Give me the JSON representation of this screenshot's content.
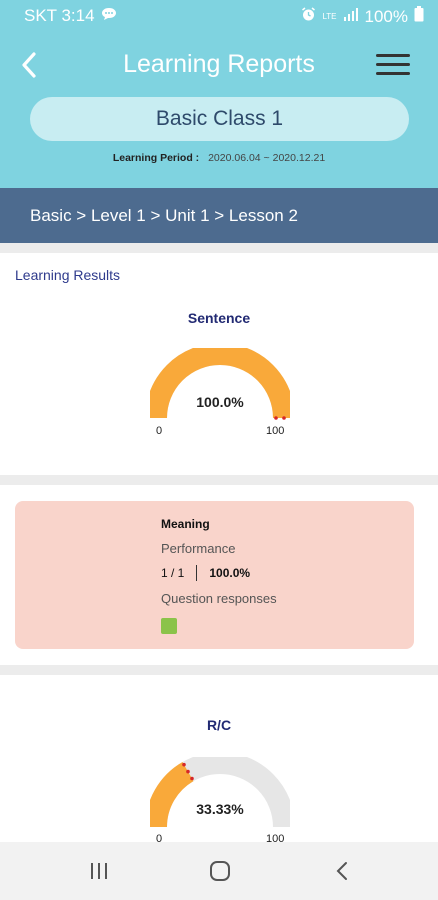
{
  "status_bar": {
    "carrier_time": "SKT 3:14",
    "network": "LTE",
    "battery": "100%",
    "icons": [
      "chat-bubble-icon",
      "alarm-icon",
      "lte-icon",
      "signal-icon",
      "battery-icon"
    ]
  },
  "header": {
    "title": "Learning Reports",
    "class_name": "Basic Class 1",
    "period_label": "Learning Period :",
    "period_value": "2020.06.04 ~ 2020.12.21"
  },
  "breadcrumb": "Basic > Level 1 > Unit 1 > Lesson 2",
  "results": {
    "section_label": "Learning Results",
    "sentence": {
      "title": "Sentence",
      "value_text": "100.0%",
      "fraction": 1.0,
      "min": "0",
      "max": "100"
    }
  },
  "meaning": {
    "title": "Meaning",
    "performance_label": "Performance",
    "score": "1 / 1",
    "percent": "100.0%",
    "responses_label": "Question responses",
    "responses": [
      "correct"
    ]
  },
  "rc": {
    "title": "R/C",
    "value_text": "33.33%",
    "fraction": 0.3333,
    "min": "0",
    "max": "100"
  },
  "colors": {
    "header_bg": "#7fd3e0",
    "breadcrumb_bg": "#4d6b8f",
    "gauge_fill": "#f9a93a",
    "gauge_track": "#e6e6e6",
    "meaning_card_bg": "#f9d4cb",
    "response_correct": "#8bc34a"
  },
  "navbar": {
    "icons": [
      "recent-apps-icon",
      "home-icon",
      "back-icon"
    ]
  }
}
